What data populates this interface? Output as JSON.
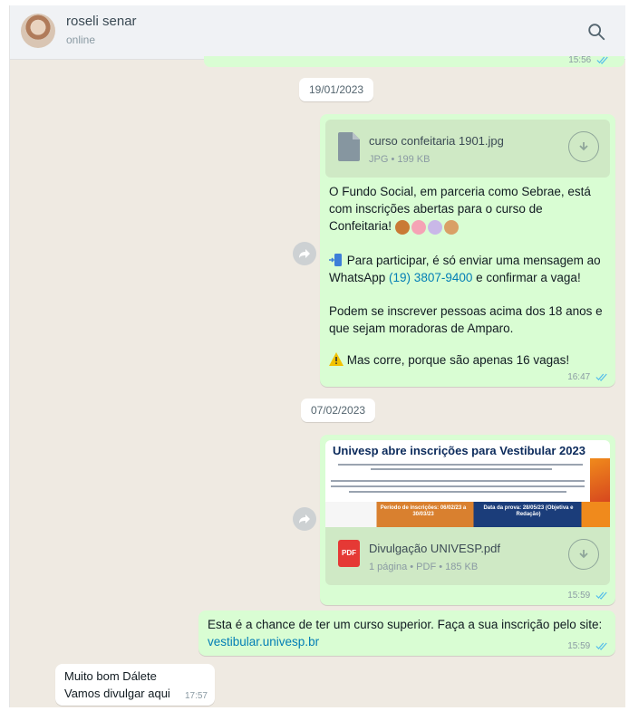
{
  "header": {
    "contact_name": "roseli senar",
    "contact_status": "online"
  },
  "top_bubble": {
    "time": "15:56"
  },
  "dates": {
    "first": "19/01/2023",
    "second": "07/02/2023"
  },
  "message_1": {
    "document": {
      "name": "curso confeitaria 1901.jpg",
      "meta": "JPG • 199 KB"
    },
    "paragraph_1": "O Fundo Social, em parceria como Sebrae, está com inscrições abertas para o curso de Confeitaria!",
    "paragraph_2_prefix": "Para participar, é só enviar uma mensagem ao WhatsApp",
    "phone": "(19) 3807-9400",
    "paragraph_2_suffix": "e confirmar a vaga!",
    "paragraph_3": "Podem se inscrever pessoas acima dos 18 anos e que sejam moradoras de Amparo.",
    "paragraph_4": "Mas corre, porque são apenas 16 vagas!",
    "time": "16:47"
  },
  "message_2": {
    "flyer_title": "Univesp abre inscrições para Vestibular 2023",
    "flyer_left_box": "Período de inscrições: 06/02/23 a 30/03/23",
    "flyer_right_box": "Data da prova: 28/05/23 (Objetiva e Redação)",
    "document": {
      "name": "Divulgação UNIVESP.pdf",
      "meta": "1 página • PDF • 185 KB"
    },
    "pdf_label": "PDF",
    "time": "15:59"
  },
  "message_3": {
    "text": "Esta é a chance de ter um curso superior. Faça a sua inscrição pelo site:",
    "link": "vestibular.univesp.br",
    "time": "15:59"
  },
  "message_4": {
    "line_1": "Muito bom Dálete",
    "line_2": "Vamos divulgar aqui",
    "time": "17:57"
  },
  "colors": {
    "outgoing_bubble": "#d9fdd3",
    "incoming_bubble": "#ffffff",
    "chat_background": "#efeae2",
    "link": "#027eb5",
    "read_ticks": "#53bdeb"
  },
  "icons": {
    "search": "search-icon",
    "forward": "forward-icon",
    "download": "download-icon",
    "file": "file-icon",
    "pdf": "pdf-icon",
    "read_ticks": "double-check-icon",
    "warning": "warning-icon",
    "phone": "phone-icon"
  }
}
